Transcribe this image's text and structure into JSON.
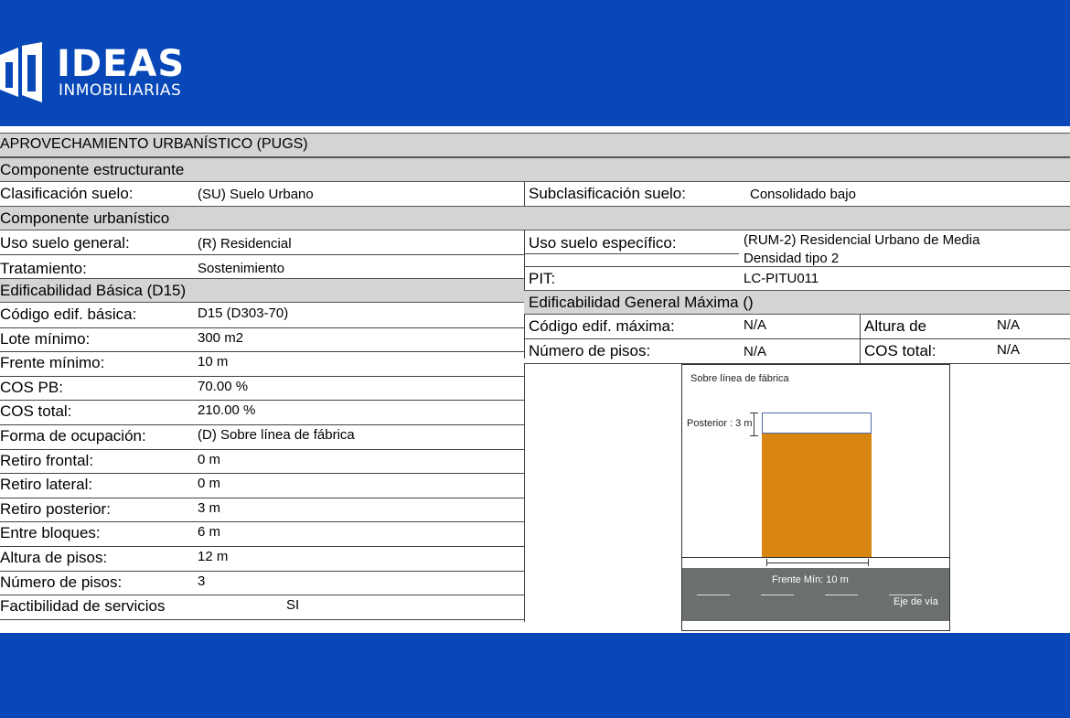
{
  "brand": {
    "name": "IDEAS",
    "tagline": "INMOBILIARIAS"
  },
  "sections": {
    "main_title": "APROVECHAMIENTO URBANÍSTICO (PUGS)",
    "estructurante": "Componente  estructurante",
    "urbanistico": "Componente  urbanístico",
    "edif_basica": "Edificabilidad Básica (D15)",
    "edif_maxima": "Edificabilidad General Máxima ()"
  },
  "estructurante": {
    "clasificacion_label": "Clasificación suelo:",
    "clasificacion_value": "(SU) Suelo Urbano",
    "subclasificacion_label": "Subclasificación suelo:",
    "subclasificacion_value": "Consolidado bajo"
  },
  "urbanistico": {
    "uso_general_label": "Uso suelo general:",
    "uso_general_value": "(R) Residencial",
    "tratamiento_label": "Tratamiento:",
    "tratamiento_value": "Sostenimiento",
    "uso_especifico_label": "Uso suelo específico:",
    "uso_especifico_value_line1": "(RUM-2) Residencial Urbano de Media",
    "uso_especifico_value_line2": "Densidad tipo 2",
    "pit_label": "PIT:",
    "pit_value": "LC-PITU011"
  },
  "basica_rows": [
    {
      "label": "Código edif. básica:",
      "value": "D15 (D303-70)"
    },
    {
      "label": "Lote mínimo:",
      "value": "300 m2"
    },
    {
      "label": "Frente mínimo:",
      "value": "10 m"
    },
    {
      "label": "COS PB:",
      "value": "70.00 %"
    },
    {
      "label": "COS total:",
      "value": "210.00 %"
    },
    {
      "label": "Forma de ocupación:",
      "value": "(D) Sobre línea de fábrica"
    },
    {
      "label": "Retiro frontal:",
      "value": "0 m"
    },
    {
      "label": "Retiro lateral:",
      "value": "0 m"
    },
    {
      "label": "Retiro posterior:",
      "value": "3 m"
    },
    {
      "label": "Entre bloques:",
      "value": "6 m"
    },
    {
      "label": "Altura de pisos:",
      "value": "12 m"
    },
    {
      "label": "Número de pisos:",
      "value": "3"
    },
    {
      "label": "Factibilidad de servicios",
      "value": "SI"
    }
  ],
  "maxima": {
    "codigo_label": "Código edif. máxima:",
    "codigo_value": "N/A",
    "altura_label": "Altura de",
    "altura_value": "N/A",
    "pisos_label": "Número de pisos:",
    "pisos_value": "N/A",
    "cos_label": "COS total:",
    "cos_value": "N/A"
  },
  "diagram": {
    "title": "Sobre línea de fábrica",
    "posterior_label": "Posterior : 3 m",
    "frente_label": "Frente Mín: 10 m",
    "eje_label": "Eje de vía",
    "building_color": "#d98512",
    "road_color": "#6b706f"
  }
}
